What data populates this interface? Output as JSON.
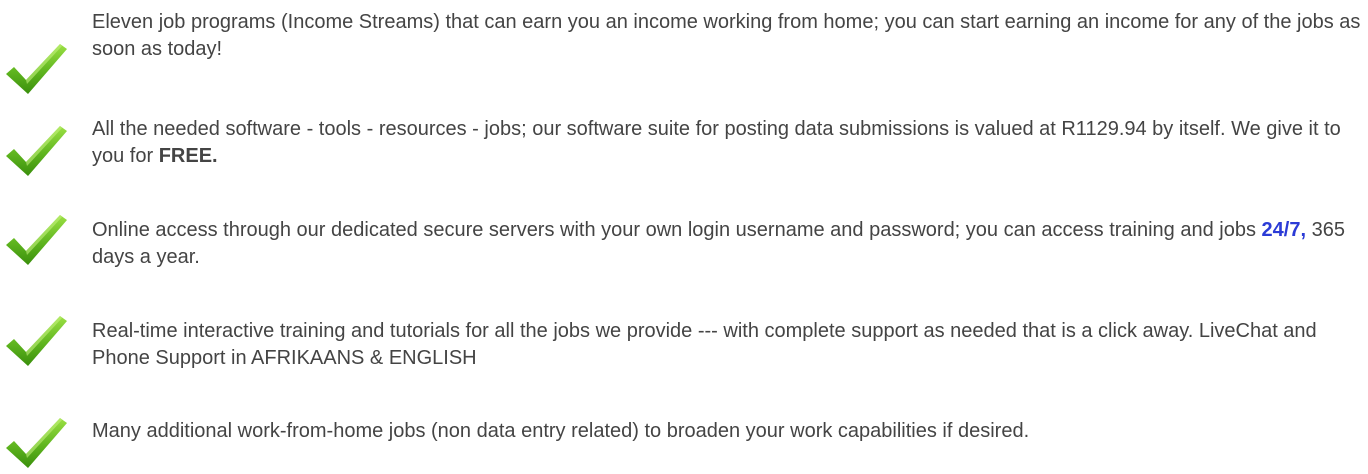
{
  "items": [
    {
      "text": "Eleven job programs (Income Streams) that can earn you an income working from home; you can start earning an income for any of the jobs as soon as today!"
    },
    {
      "text_before": "All the needed software - tools - resources - jobs; our software suite for posting data submissions is valued at R1129.94 by itself. We give it to you for ",
      "strong": "FREE."
    },
    {
      "text_before": "Online access through our dedicated secure servers with your own login username and password; you can access training and jobs ",
      "strong": "24/7,",
      "text_after": " 365 days a year."
    },
    {
      "text": "Real-time interactive training and tutorials for all the jobs we provide --- with complete support as needed that is a click away. LiveChat and Phone Support in AFRIKAANS & ENGLISH"
    },
    {
      "text": "Many additional work-from-home jobs (non data entry related) to broaden your work capabilities if desired."
    }
  ],
  "icon": "checkmark-icon",
  "colors": {
    "text": "#444444",
    "highlight": "#2b3bd6",
    "check_light": "#8ed63a",
    "check_dark": "#3f9a0f"
  }
}
